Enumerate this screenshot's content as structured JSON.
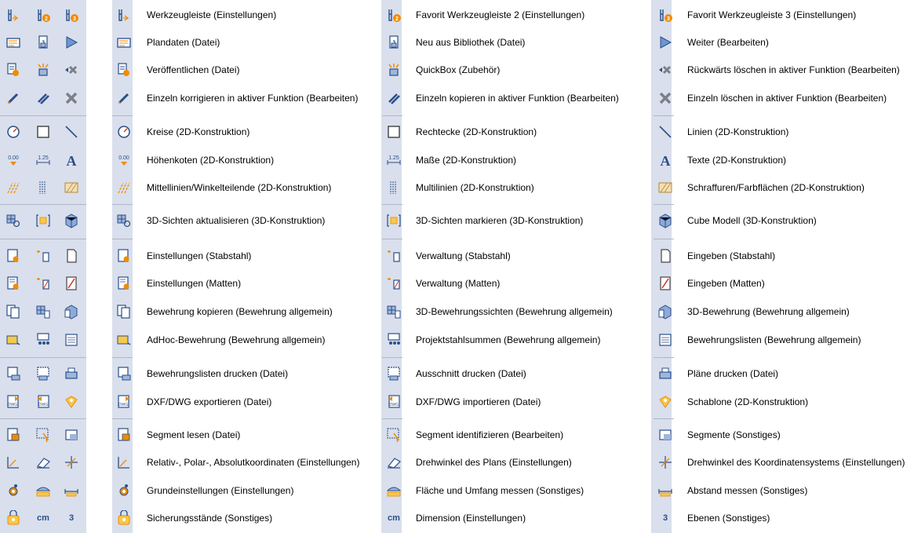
{
  "toolbar": {
    "rows": [
      [
        "toolbar-settings-icon",
        "favorite-toolbar-2-icon",
        "favorite-toolbar-3-icon"
      ],
      [
        "plan-data-icon",
        "new-from-library-icon",
        "continue-arrow-icon"
      ],
      [
        "publish-icon",
        "quickbox-icon",
        "delete-backwards-icon"
      ],
      [
        "correct-single-icon",
        "copy-single-icon",
        "delete-single-icon"
      ],
      [
        "circle-icon",
        "rectangle-icon",
        "line-icon"
      ],
      [
        "elevation-marker-icon",
        "dimension-icon",
        "text-a-icon"
      ],
      [
        "centerline-icon",
        "multiline-icon",
        "hatching-icon"
      ],
      [
        "refresh-3d-views-icon",
        "mark-3d-views-icon",
        "cube-model-icon"
      ],
      [
        "rebar-settings-icon",
        "rebar-management-icon",
        "rebar-input-icon"
      ],
      [
        "mesh-settings-icon",
        "mesh-management-icon",
        "mesh-input-icon"
      ],
      [
        "copy-reinforcement-icon",
        "3d-reinforcement-views-icon",
        "3d-reinforcement-icon"
      ],
      [
        "adhoc-reinforcement-icon",
        "project-steel-totals-icon",
        "reinforcement-lists-icon"
      ],
      [
        "print-reinforcement-lists-icon",
        "print-section-icon",
        "print-plans-icon"
      ],
      [
        "dxf-export-icon",
        "dxf-import-icon",
        "template-icon"
      ],
      [
        "read-segment-icon",
        "identify-segment-icon",
        "segments-icon"
      ],
      [
        "coordinates-icon",
        "plan-rotation-icon",
        "coordinate-system-rotation-icon"
      ],
      [
        "basic-settings-icon",
        "measure-area-icon",
        "measure-distance-icon"
      ],
      [
        "backups-icon",
        "dimension-cm-icon",
        "layers-3-icon"
      ]
    ],
    "text_glyphs": {
      "cm": "cm",
      "three": "3"
    }
  },
  "columns": [
    {
      "items": [
        {
          "icon": "toolbar-settings-icon",
          "label": "Werkzeugleiste (Einstellungen)"
        },
        {
          "icon": "plan-data-icon",
          "label": "Plandaten (Datei)"
        },
        {
          "icon": "publish-icon",
          "label": "Veröffentlichen (Datei)"
        },
        {
          "icon": "correct-single-icon",
          "label": "Einzeln korrigieren in aktiver Funktion (Bearbeiten)"
        },
        {
          "icon": "circle-icon",
          "label": "Kreise (2D-Konstruktion)"
        },
        {
          "icon": "elevation-marker-icon",
          "label": "Höhenkoten (2D-Konstruktion)"
        },
        {
          "icon": "centerline-icon",
          "label": "Mittellinien/Winkelteilende (2D-Konstruktion)"
        },
        {
          "icon": "refresh-3d-views-icon",
          "label": "3D-Sichten aktualisieren (3D-Konstruktion)"
        },
        {
          "icon": "rebar-settings-icon",
          "label": "Einstellungen (Stabstahl)"
        },
        {
          "icon": "mesh-settings-icon",
          "label": "Einstellungen (Matten)"
        },
        {
          "icon": "copy-reinforcement-icon",
          "label": "Bewehrung kopieren (Bewehrung allgemein)"
        },
        {
          "icon": "adhoc-reinforcement-icon",
          "label": "AdHoc-Bewehrung (Bewehrung allgemein)"
        },
        {
          "icon": "print-reinforcement-lists-icon",
          "label": "Bewehrungslisten drucken (Datei)"
        },
        {
          "icon": "dxf-export-icon",
          "label": "DXF/DWG exportieren (Datei)"
        },
        {
          "icon": "read-segment-icon",
          "label": "Segment lesen (Datei)"
        },
        {
          "icon": "coordinates-icon",
          "label": "Relativ-, Polar-, Absolutkoordinaten (Einstellungen)"
        },
        {
          "icon": "basic-settings-icon",
          "label": "Grundeinstellungen (Einstellungen)"
        },
        {
          "icon": "backups-icon",
          "label": "Sicherungsstände (Sonstiges)"
        }
      ]
    },
    {
      "items": [
        {
          "icon": "favorite-toolbar-2-icon",
          "label": "Favorit Werkzeugleiste 2 (Einstellungen)"
        },
        {
          "icon": "new-from-library-icon",
          "label": "Neu aus Bibliothek (Datei)"
        },
        {
          "icon": "quickbox-icon",
          "label": "QuickBox (Zubehör)"
        },
        {
          "icon": "copy-single-icon",
          "label": "Einzeln kopieren in aktiver Funktion (Bearbeiten)"
        },
        {
          "icon": "rectangle-icon",
          "label": "Rechtecke (2D-Konstruktion)"
        },
        {
          "icon": "dimension-icon",
          "label": "Maße (2D-Konstruktion)"
        },
        {
          "icon": "multiline-icon",
          "label": "Multilinien (2D-Konstruktion)"
        },
        {
          "icon": "mark-3d-views-icon",
          "label": "3D-Sichten markieren (3D-Konstruktion)"
        },
        {
          "icon": "rebar-management-icon",
          "label": "Verwaltung (Stabstahl)"
        },
        {
          "icon": "mesh-management-icon",
          "label": "Verwaltung (Matten)"
        },
        {
          "icon": "3d-reinforcement-views-icon",
          "label": "3D-Bewehrungssichten (Bewehrung allgemein)"
        },
        {
          "icon": "project-steel-totals-icon",
          "label": "Projektstahlsummen (Bewehrung allgemein)"
        },
        {
          "icon": "print-section-icon",
          "label": "Ausschnitt drucken (Datei)"
        },
        {
          "icon": "dxf-import-icon",
          "label": "DXF/DWG importieren (Datei)"
        },
        {
          "icon": "identify-segment-icon",
          "label": "Segment identifizieren (Bearbeiten)"
        },
        {
          "icon": "plan-rotation-icon",
          "label": "Drehwinkel des Plans (Einstellungen)"
        },
        {
          "icon": "measure-area-icon",
          "label": "Fläche und Umfang messen (Sonstiges)"
        },
        {
          "icon": "dimension-cm-icon",
          "label": "Dimension (Einstellungen)"
        }
      ]
    },
    {
      "items": [
        {
          "icon": "favorite-toolbar-3-icon",
          "label": "Favorit Werkzeugleiste 3 (Einstellungen)"
        },
        {
          "icon": "continue-arrow-icon",
          "label": "Weiter (Bearbeiten)"
        },
        {
          "icon": "delete-backwards-icon",
          "label": "Rückwärts löschen in aktiver Funktion (Bearbeiten)"
        },
        {
          "icon": "delete-single-icon",
          "label": "Einzeln löschen in aktiver Funktion (Bearbeiten)"
        },
        {
          "icon": "line-icon",
          "label": "Linien (2D-Konstruktion)"
        },
        {
          "icon": "text-a-icon",
          "label": "Texte (2D-Konstruktion)"
        },
        {
          "icon": "hatching-icon",
          "label": "Schraffuren/Farbflächen (2D-Konstruktion)"
        },
        {
          "icon": "cube-model-icon",
          "label": "Cube Modell (3D-Konstruktion)"
        },
        {
          "icon": "rebar-input-icon",
          "label": "Eingeben (Stabstahl)"
        },
        {
          "icon": "mesh-input-icon",
          "label": "Eingeben (Matten)"
        },
        {
          "icon": "3d-reinforcement-icon",
          "label": "3D-Bewehrung (Bewehrung allgemein)"
        },
        {
          "icon": "reinforcement-lists-icon",
          "label": "Bewehrungslisten (Bewehrung allgemein)"
        },
        {
          "icon": "print-plans-icon",
          "label": "Pläne drucken (Datei)"
        },
        {
          "icon": "template-icon",
          "label": "Schablone (2D-Konstruktion)"
        },
        {
          "icon": "segments-icon",
          "label": "Segmente (Sonstiges)"
        },
        {
          "icon": "coordinate-system-rotation-icon",
          "label": "Drehwinkel des Koordinatensystems (Einstellungen)"
        },
        {
          "icon": "measure-distance-icon",
          "label": "Abstand messen (Sonstiges)"
        },
        {
          "icon": "layers-3-icon",
          "label": "Ebenen (Sonstiges)"
        }
      ]
    }
  ],
  "colors": {
    "strip": "#d9dfec",
    "separator": "#aeb6c8",
    "icon_blue": "#2b4f8a",
    "icon_orange": "#f08c00",
    "icon_red": "#d03020",
    "icon_gray": "#7a7f88"
  }
}
